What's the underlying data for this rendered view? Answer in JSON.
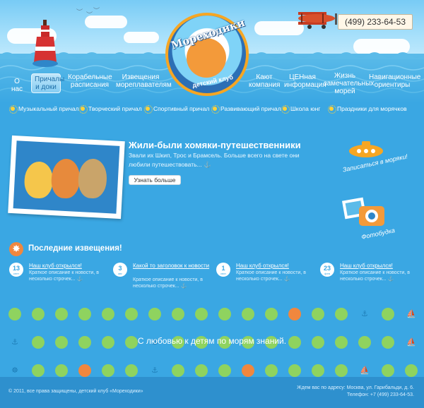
{
  "header": {
    "phone": "(499) 233-64-53",
    "logo_title": "Мореходики",
    "logo_subtitle": "детский клуб"
  },
  "nav": [
    {
      "label": "О нас"
    },
    {
      "label": "Причалы и доки"
    },
    {
      "label": "Корабельные расписания"
    },
    {
      "label": "Извещения мореплавателям"
    },
    {
      "label": "Кают компания"
    },
    {
      "label": "ЦЕНная информация"
    },
    {
      "label": "Жизнь замечательных морей"
    },
    {
      "label": "Навигационные ориентиры"
    }
  ],
  "subnav": [
    {
      "label": "Музыкальный причал"
    },
    {
      "label": "Творческий причал"
    },
    {
      "label": "Спортивный причал"
    },
    {
      "label": "Развивающий причал"
    },
    {
      "label": "Школа юнг"
    },
    {
      "label": "Праздники для морячков"
    }
  ],
  "hero": {
    "title": "Жили-были хомяки-путешественники",
    "text": "Звали их Шкип, Трос и Брамсель. Больше всего на свете они любили путешествовать... ⚓",
    "button": "Узнать больше"
  },
  "side_links": {
    "signup": "Записаться в моряки!",
    "photo": "Фотобудка"
  },
  "news": {
    "heading": "Последние извещения!",
    "items": [
      {
        "day": "13",
        "month": "сент",
        "title": "Наш клуб открылся!",
        "desc": "Краткое описание к новости, в несколько строчек... ⚓"
      },
      {
        "day": "3",
        "month": "авг",
        "title": "Какой то заголовок к новости",
        "desc": "Краткое описание к новости, в несколько строчек... ⚓"
      },
      {
        "day": "1",
        "month": "июн",
        "title": "Наш клуб открылся!",
        "desc": "Краткое описание к новости, в несколько строчек... ⚓"
      },
      {
        "day": "23",
        "month": "фев",
        "title": "Наш клуб открылся!",
        "desc": "Краткое описание к новости, в несколько строчек... ⚓"
      }
    ]
  },
  "slogan": "С любовью к детям по морям знаний.",
  "footer": {
    "copyright": "© 2011, все права защищены, детский клуб «Мореходики»",
    "address": "Ждем вас по адресу: Москва, ул. Гарибальди, д. 6.",
    "phone": "Телефон: +7 (499) 233-64-53."
  },
  "colors": {
    "background": "#3aa7e3",
    "dot_green": "#8fd35f",
    "dot_orange": "#f0873e",
    "dot_light": "#dff2fd",
    "accent_yellow": "#ffd23a"
  },
  "icons": [
    "buoy-icon",
    "airplane-icon",
    "sun-icon",
    "submarine-icon",
    "camera-icon",
    "starfish-icon",
    "anchor-icon",
    "sailboat-icon",
    "helm-icon"
  ]
}
